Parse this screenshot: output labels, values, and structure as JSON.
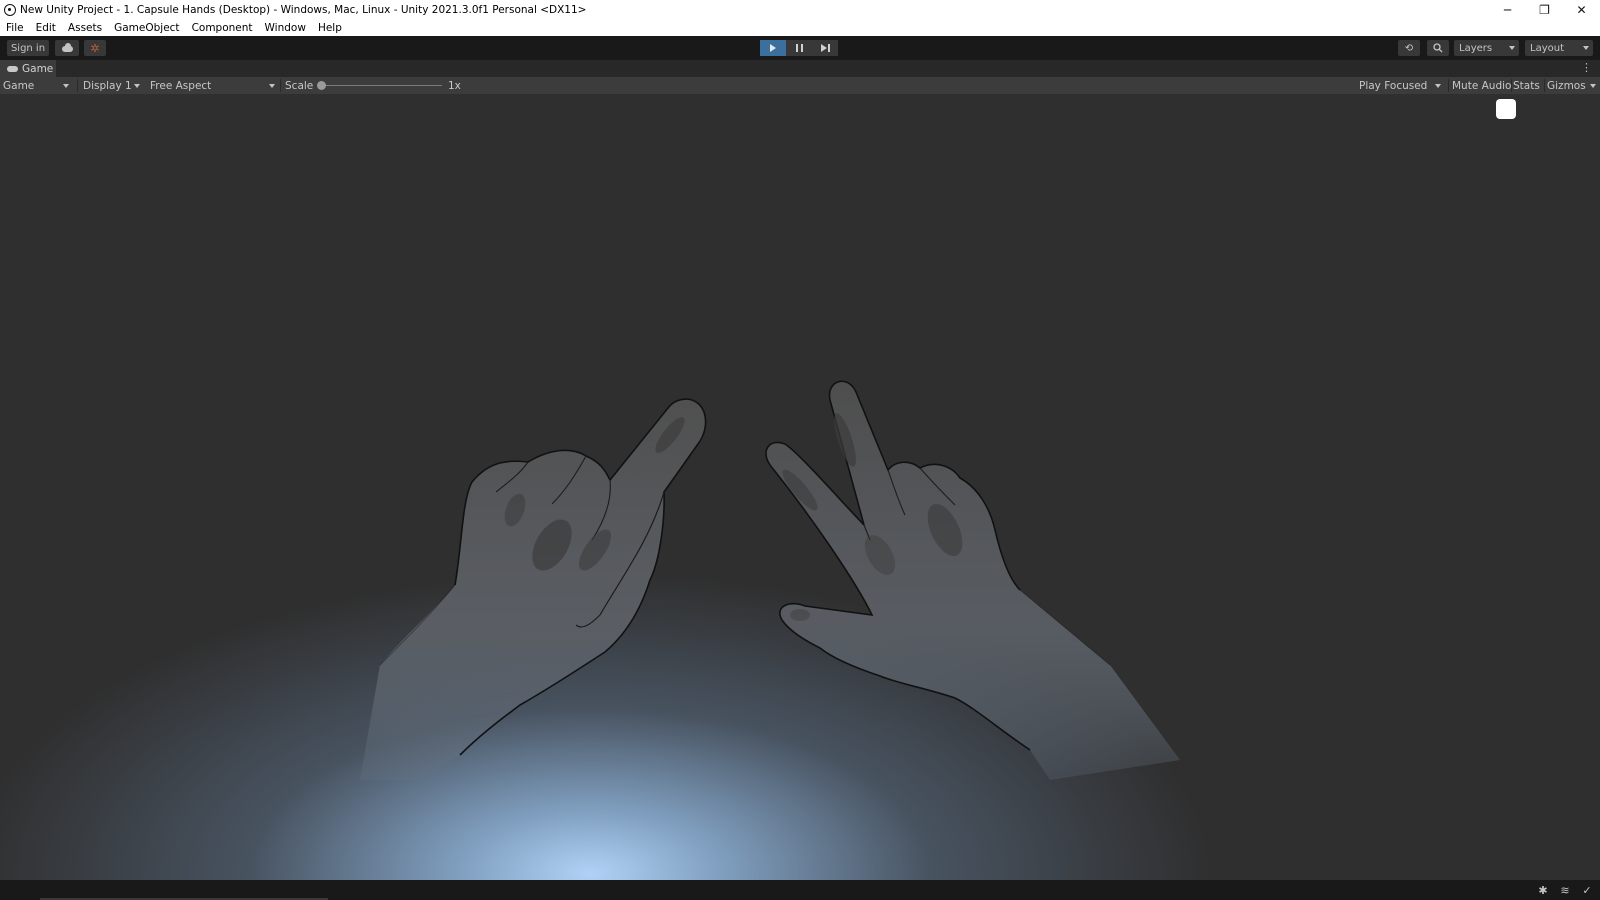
{
  "window": {
    "title": "New Unity Project - 1. Capsule Hands (Desktop) - Windows, Mac, Linux - Unity 2021.3.0f1 Personal <DX11>",
    "controls": {
      "minimize": "─",
      "restore": "❐",
      "close": "✕"
    }
  },
  "menu": {
    "items": [
      {
        "label": "File"
      },
      {
        "label": "Edit"
      },
      {
        "label": "Assets"
      },
      {
        "label": "GameObject"
      },
      {
        "label": "Component"
      },
      {
        "label": "Window"
      },
      {
        "label": "Help"
      }
    ]
  },
  "toolbar": {
    "sign_in": "Sign in",
    "cloud_icon": "cloud-icon",
    "collab_icon": "collab-icon",
    "play_state": "playing",
    "layers": "Layers",
    "layout": "Layout",
    "accent_play": "#3c6e9e"
  },
  "game_tab": {
    "label": "Game",
    "menu_glyph": "⋮"
  },
  "game_toolbar": {
    "mode": "Game",
    "display": "Display 1",
    "aspect": "Free Aspect",
    "scale_label": "Scale",
    "scale_value": "1x",
    "play_focused": "Play Focused",
    "mute_audio": "Mute Audio",
    "stats": "Stats",
    "gizmos": "Gizmos"
  },
  "scene": {
    "description_icon": "capsule-hands",
    "background": "#2f2f2f",
    "glow_color": "#b0d2f6"
  }
}
